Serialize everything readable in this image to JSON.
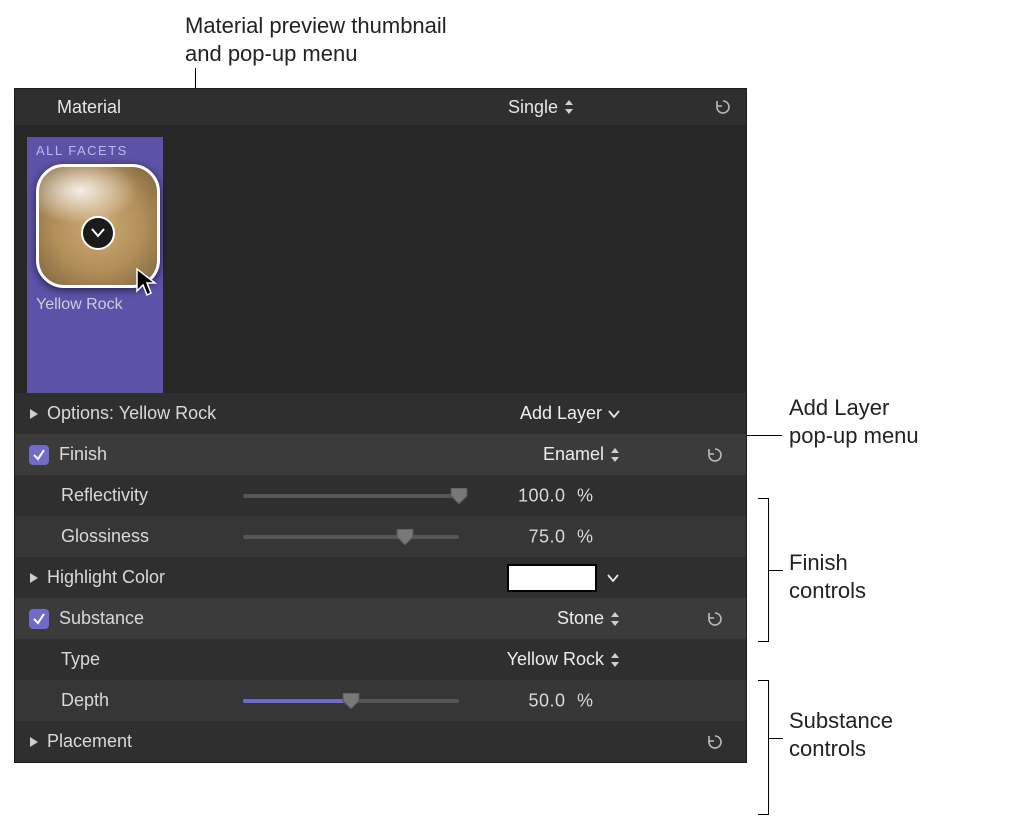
{
  "callouts": {
    "thumbnail": "Material preview thumbnail\nand pop-up menu",
    "add_layer": "Add Layer\npop-up menu",
    "finish_controls": "Finish\ncontrols",
    "substance_controls": "Substance\ncontrols"
  },
  "panel": {
    "title": "Material",
    "mode_popup": "Single"
  },
  "facet": {
    "tag": "ALL FACETS",
    "material_name": "Yellow Rock"
  },
  "options_row": {
    "label": "Options: Yellow Rock",
    "add_layer": "Add Layer"
  },
  "finish": {
    "label": "Finish",
    "popup": "Enamel",
    "reflectivity_label": "Reflectivity",
    "reflectivity_value": "100.0",
    "glossiness_label": "Glossiness",
    "glossiness_value": "75.0",
    "highlight_color_label": "Highlight Color",
    "highlight_color": "#ffffff",
    "unit": "%"
  },
  "substance": {
    "label": "Substance",
    "popup": "Stone",
    "type_label": "Type",
    "type_value": "Yellow Rock",
    "depth_label": "Depth",
    "depth_value": "50.0",
    "unit": "%"
  },
  "placement": {
    "label": "Placement"
  },
  "chart_data": {
    "type": "table",
    "title": "Material controls",
    "rows": [
      {
        "parameter": "Reflectivity",
        "value": 100.0,
        "unit": "%"
      },
      {
        "parameter": "Glossiness",
        "value": 75.0,
        "unit": "%"
      },
      {
        "parameter": "Depth",
        "value": 50.0,
        "unit": "%"
      }
    ]
  }
}
